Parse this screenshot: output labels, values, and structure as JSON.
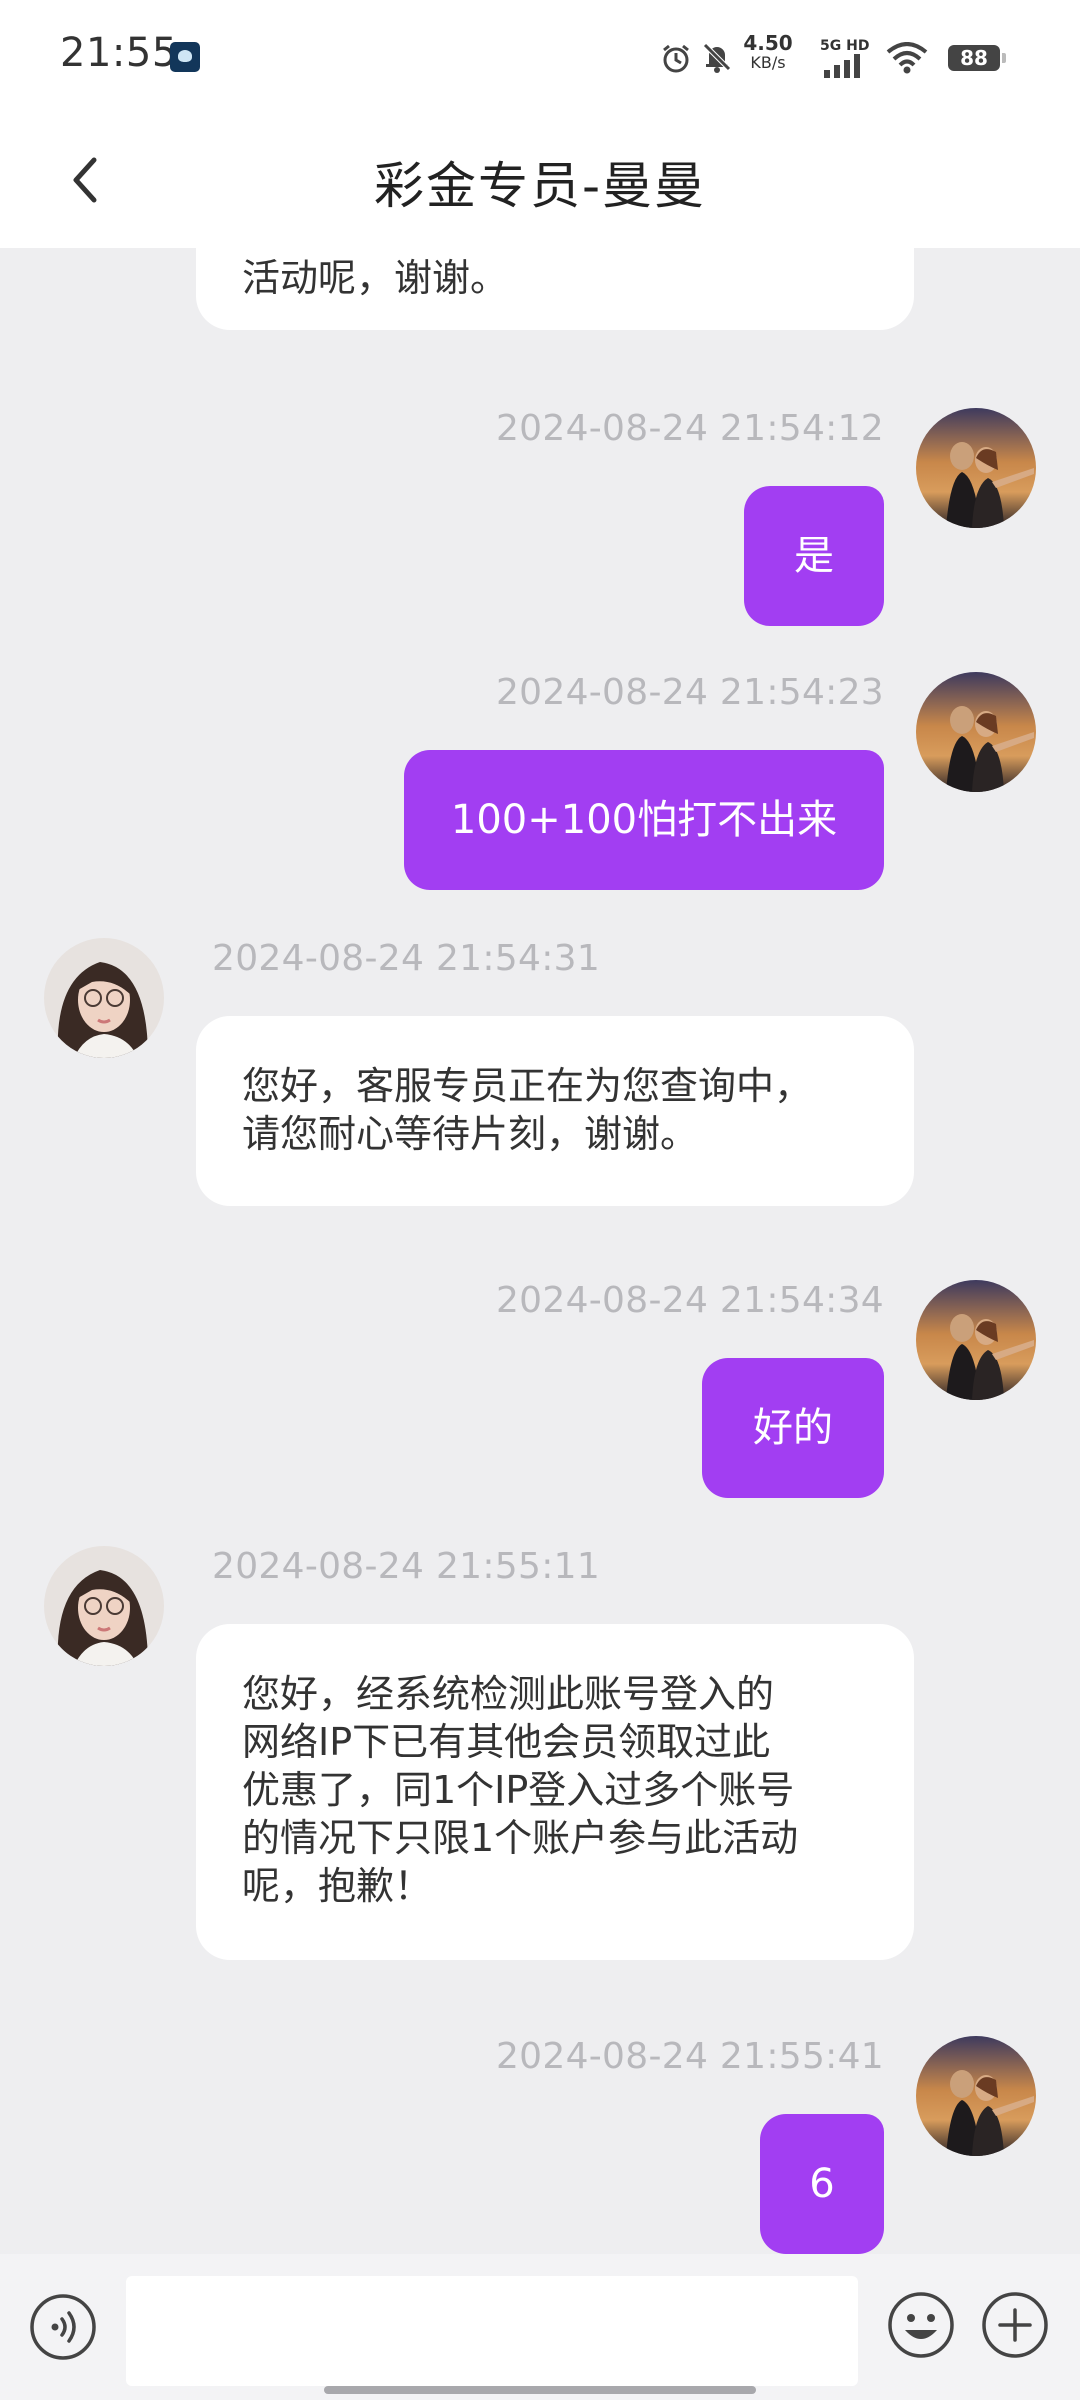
{
  "status_bar": {
    "time": "21:55",
    "net_speed_value": "4.50",
    "net_speed_unit": "KB/s",
    "network_label": "5G HD",
    "battery": "88",
    "icons": [
      "app-notification-icon",
      "alarm-icon",
      "mute-icon",
      "signal-icon",
      "wifi-icon",
      "battery-icon"
    ]
  },
  "header": {
    "title": "彩金专员-曼曼",
    "back_icon": "chevron-left-icon"
  },
  "messages": [
    {
      "from": "agent",
      "text": "活动呢，谢谢。",
      "partial": true
    },
    {
      "from": "user",
      "time": "2024-08-24 21:54:12",
      "text": "是"
    },
    {
      "from": "user",
      "time": "2024-08-24 21:54:23",
      "text": "100+100怕打不出来"
    },
    {
      "from": "agent",
      "time": "2024-08-24 21:54:31",
      "lines": [
        "您好，客服专员正在为您查询中，",
        "请您耐心等待片刻，谢谢。"
      ]
    },
    {
      "from": "user",
      "time": "2024-08-24 21:54:34",
      "text": "好的"
    },
    {
      "from": "agent",
      "time": "2024-08-24 21:55:11",
      "lines": [
        "您好，经系统检测此账号登入的",
        "网络IP下已有其他会员领取过此",
        "优惠了，同1个IP登入过多个账号",
        "的情况下只限1个账户参与此活动",
        "呢，抱歉！"
      ]
    },
    {
      "from": "user",
      "time": "2024-08-24 21:55:41",
      "text": "6"
    }
  ],
  "input_bar": {
    "placeholder": "",
    "value": "",
    "icons": [
      "voice-icon",
      "emoji-icon",
      "plus-icon"
    ]
  },
  "colors": {
    "outgoing_bubble": "#a23ef2",
    "incoming_bubble": "#ffffff",
    "background": "#eeeef0",
    "timestamp": "#b8b8bc"
  }
}
